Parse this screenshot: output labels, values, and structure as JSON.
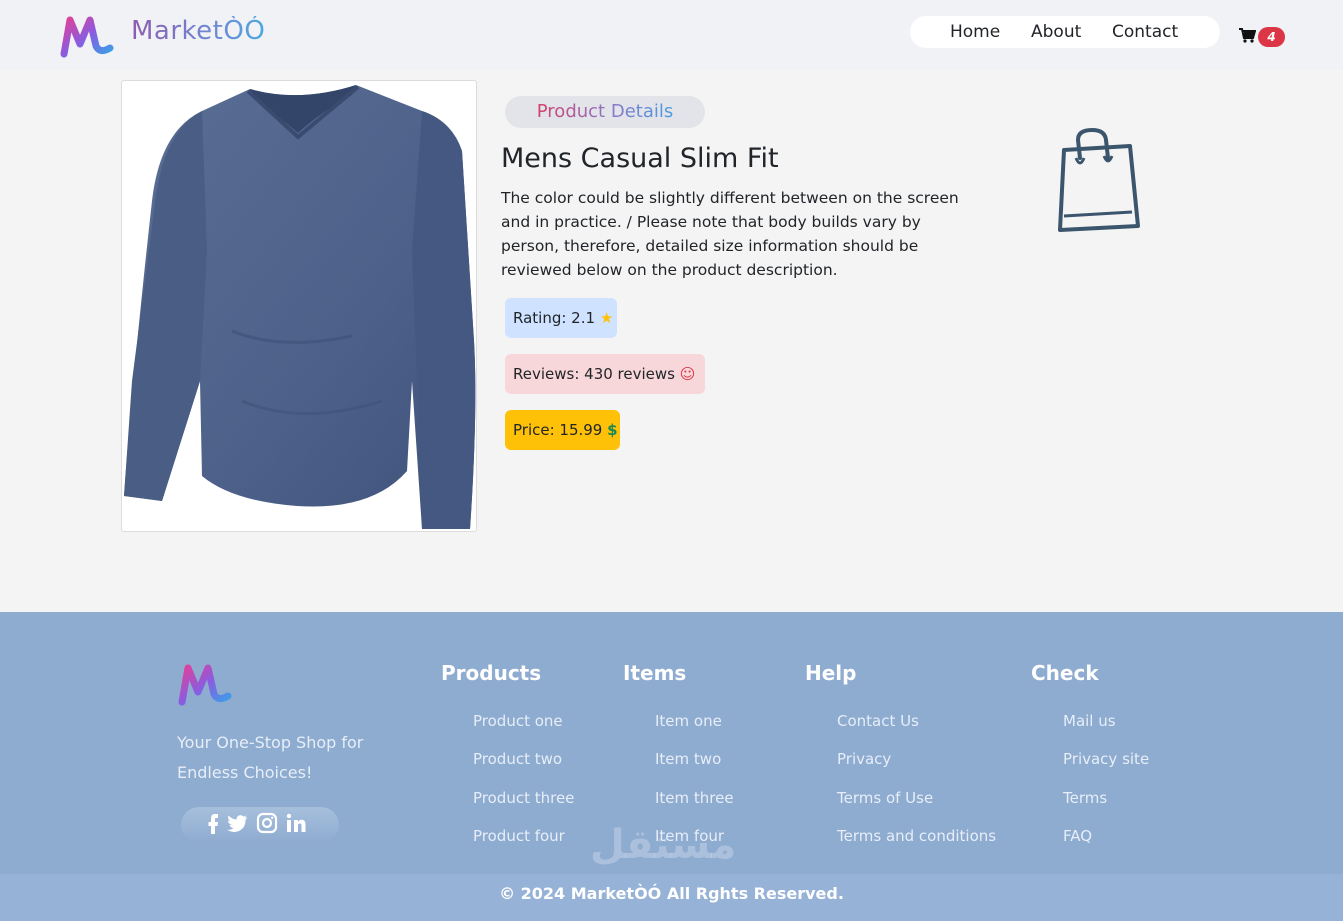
{
  "brand": {
    "name": "MarketÒÓ"
  },
  "nav": {
    "home": "Home",
    "about": "About",
    "contact": "Contact"
  },
  "cart": {
    "count": "4"
  },
  "product": {
    "section_label": "Product Details",
    "name": "Mens Casual Slim Fit",
    "description": "The color could be slightly different between on the screen and in practice. / Please note that body builds vary by person, therefore, detailed size information should be reviewed below on the product description.",
    "rating_label": "Rating: 2.1",
    "reviews_label": "Reviews: 430 reviews",
    "price_label": "Price: 15.99",
    "currency_symbol": "$"
  },
  "footer": {
    "tagline": "Your One-Stop Shop for Endless Choices!",
    "columns": [
      {
        "title": "Products",
        "links": [
          "Product one",
          "Product two",
          "Product three",
          "Product four"
        ]
      },
      {
        "title": "Items",
        "links": [
          "Item one",
          "Item two",
          "Item three",
          "Item four"
        ]
      },
      {
        "title": "Help",
        "links": [
          "Contact Us",
          "Privacy",
          "Terms of Use",
          "Terms and conditions"
        ]
      },
      {
        "title": "Check",
        "links": [
          "Mail us",
          "Privacy site",
          "Terms",
          "FAQ"
        ]
      }
    ],
    "social_icons": [
      "facebook-icon",
      "twitter-icon",
      "instagram-icon",
      "linkedin-icon"
    ],
    "watermark": "مستقل",
    "copyright": "© 2024 MarketÒÓ All Rghts Reserved."
  },
  "colors": {
    "header_bg": "#f0f2f5",
    "page_bg": "#f4f4f4",
    "footer_bg": "#8eabd0",
    "badge": "#dc3545",
    "rating_bg": "#cfe2ff",
    "reviews_bg": "#f8d7da",
    "price_bg": "#ffc107"
  }
}
